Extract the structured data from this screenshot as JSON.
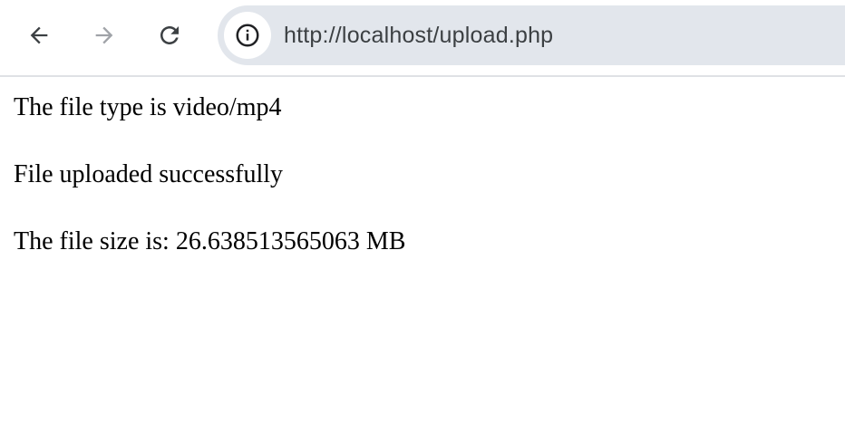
{
  "browser": {
    "address_bar": {
      "url": "http://localhost/upload.php",
      "site_info_icon": "info-icon"
    },
    "nav": {
      "back_icon": "arrow-left-icon",
      "forward_icon": "arrow-right-icon",
      "reload_icon": "reload-icon"
    }
  },
  "page": {
    "lines": [
      "The file type is video/mp4",
      "File uploaded successfully",
      "The file size is: 26.638513565063 MB"
    ]
  }
}
